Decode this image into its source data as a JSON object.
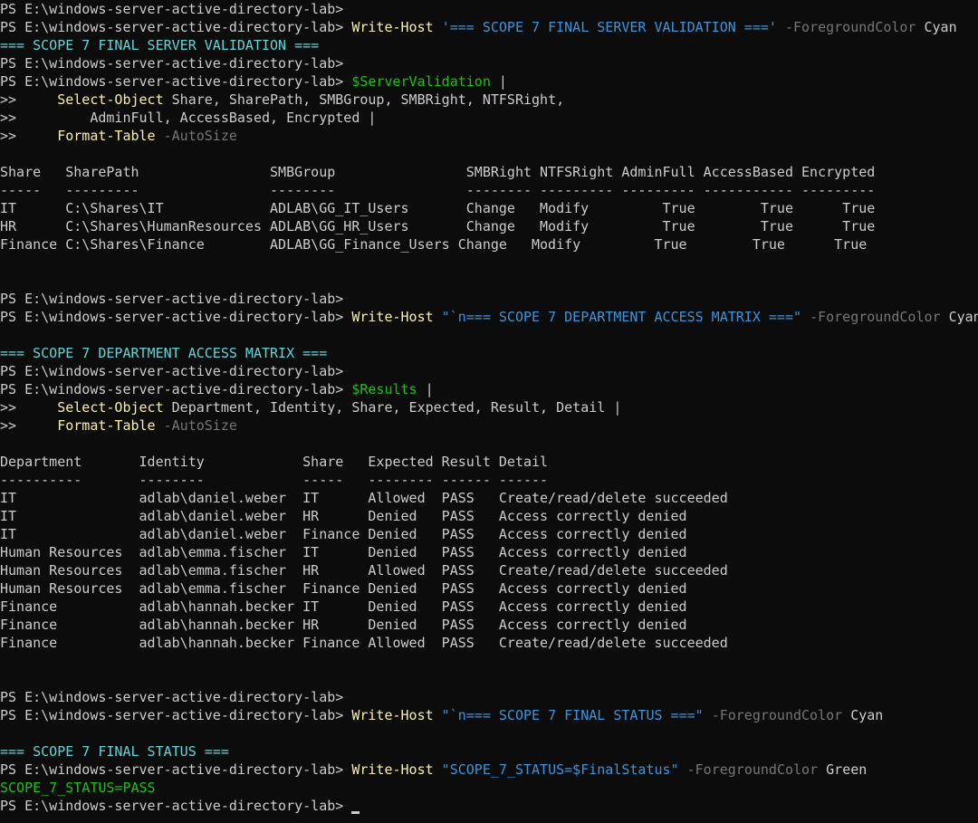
{
  "lines": [
    [
      {
        "t": "PS E:\\windows-server-active-directory-lab>",
        "c": "w"
      }
    ],
    [
      {
        "t": "PS E:\\windows-server-active-directory-lab> ",
        "c": "w"
      },
      {
        "t": "Write-Host",
        "c": "y"
      },
      {
        "t": " ",
        "c": "w"
      },
      {
        "t": "'=== SCOPE 7 FINAL SERVER VALIDATION ==='",
        "c": "c"
      },
      {
        "t": " ",
        "c": "w"
      },
      {
        "t": "-ForegroundColor",
        "c": "g"
      },
      {
        "t": " Cyan",
        "c": "w"
      }
    ],
    [
      {
        "t": "=== SCOPE 7 FINAL SERVER VALIDATION ===",
        "c": "cy"
      }
    ],
    [
      {
        "t": "PS E:\\windows-server-active-directory-lab>",
        "c": "w"
      }
    ],
    [
      {
        "t": "PS E:\\windows-server-active-directory-lab> ",
        "c": "w"
      },
      {
        "t": "$ServerValidation",
        "c": "gr"
      },
      {
        "t": " |",
        "c": "w"
      }
    ],
    [
      {
        "t": ">>     ",
        "c": "w"
      },
      {
        "t": "Select-Object",
        "c": "y"
      },
      {
        "t": " Share, SharePath, SMBGroup, SMBRight, NTFSRight,",
        "c": "w"
      }
    ],
    [
      {
        "t": ">>         AdminFull, AccessBased, Encrypted |",
        "c": "w"
      }
    ],
    [
      {
        "t": ">>     ",
        "c": "w"
      },
      {
        "t": "Format-Table",
        "c": "y"
      },
      {
        "t": " ",
        "c": "w"
      },
      {
        "t": "-AutoSize",
        "c": "g"
      }
    ],
    [],
    [
      {
        "t": "Share   SharePath                SMBGroup                SMBRight NTFSRight AdminFull AccessBased Encrypted",
        "c": "w"
      }
    ],
    [
      {
        "t": "-----   ---------                --------                -------- --------- --------- ----------- ---------",
        "c": "w"
      }
    ],
    [
      {
        "t": "IT      C:\\Shares\\IT             ADLAB\\GG_IT_Users       Change   Modify         True        True      True",
        "c": "w"
      }
    ],
    [
      {
        "t": "HR      C:\\Shares\\HumanResources ADLAB\\GG_HR_Users       Change   Modify         True        True      True",
        "c": "w"
      }
    ],
    [
      {
        "t": "Finance C:\\Shares\\Finance        ADLAB\\GG_Finance_Users Change   Modify         True        True      True",
        "c": "w"
      }
    ],
    [],
    [],
    [
      {
        "t": "PS E:\\windows-server-active-directory-lab>",
        "c": "w"
      }
    ],
    [
      {
        "t": "PS E:\\windows-server-active-directory-lab> ",
        "c": "w"
      },
      {
        "t": "Write-Host",
        "c": "y"
      },
      {
        "t": " ",
        "c": "w"
      },
      {
        "t": "\"`n=== SCOPE 7 DEPARTMENT ACCESS MATRIX ===\"",
        "c": "c"
      },
      {
        "t": " ",
        "c": "w"
      },
      {
        "t": "-ForegroundColor",
        "c": "g"
      },
      {
        "t": " Cyan",
        "c": "w"
      }
    ],
    [],
    [
      {
        "t": "=== SCOPE 7 DEPARTMENT ACCESS MATRIX ===",
        "c": "cy"
      }
    ],
    [
      {
        "t": "PS E:\\windows-server-active-directory-lab>",
        "c": "w"
      }
    ],
    [
      {
        "t": "PS E:\\windows-server-active-directory-lab> ",
        "c": "w"
      },
      {
        "t": "$Results",
        "c": "gr"
      },
      {
        "t": " |",
        "c": "w"
      }
    ],
    [
      {
        "t": ">>     ",
        "c": "w"
      },
      {
        "t": "Select-Object",
        "c": "y"
      },
      {
        "t": " Department, Identity, Share, Expected, Result, Detail |",
        "c": "w"
      }
    ],
    [
      {
        "t": ">>     ",
        "c": "w"
      },
      {
        "t": "Format-Table",
        "c": "y"
      },
      {
        "t": " ",
        "c": "w"
      },
      {
        "t": "-AutoSize",
        "c": "g"
      }
    ],
    [],
    [
      {
        "t": "Department       Identity            Share   Expected Result Detail",
        "c": "w"
      }
    ],
    [
      {
        "t": "----------       --------            -----   -------- ------ ------",
        "c": "w"
      }
    ],
    [
      {
        "t": "IT               adlab\\daniel.weber  IT      Allowed  PASS   Create/read/delete succeeded",
        "c": "w"
      }
    ],
    [
      {
        "t": "IT               adlab\\daniel.weber  HR      Denied   PASS   Access correctly denied",
        "c": "w"
      }
    ],
    [
      {
        "t": "IT               adlab\\daniel.weber  Finance Denied   PASS   Access correctly denied",
        "c": "w"
      }
    ],
    [
      {
        "t": "Human Resources  adlab\\emma.fischer  IT      Denied   PASS   Access correctly denied",
        "c": "w"
      }
    ],
    [
      {
        "t": "Human Resources  adlab\\emma.fischer  HR      Allowed  PASS   Create/read/delete succeeded",
        "c": "w"
      }
    ],
    [
      {
        "t": "Human Resources  adlab\\emma.fischer  Finance Denied   PASS   Access correctly denied",
        "c": "w"
      }
    ],
    [
      {
        "t": "Finance          adlab\\hannah.becker IT      Denied   PASS   Access correctly denied",
        "c": "w"
      }
    ],
    [
      {
        "t": "Finance          adlab\\hannah.becker HR      Denied   PASS   Access correctly denied",
        "c": "w"
      }
    ],
    [
      {
        "t": "Finance          adlab\\hannah.becker Finance Allowed  PASS   Create/read/delete succeeded",
        "c": "w"
      }
    ],
    [],
    [],
    [
      {
        "t": "PS E:\\windows-server-active-directory-lab>",
        "c": "w"
      }
    ],
    [
      {
        "t": "PS E:\\windows-server-active-directory-lab> ",
        "c": "w"
      },
      {
        "t": "Write-Host",
        "c": "y"
      },
      {
        "t": " ",
        "c": "w"
      },
      {
        "t": "\"`n=== SCOPE 7 FINAL STATUS ===\"",
        "c": "c"
      },
      {
        "t": " ",
        "c": "w"
      },
      {
        "t": "-ForegroundColor",
        "c": "g"
      },
      {
        "t": " Cyan",
        "c": "w"
      }
    ],
    [],
    [
      {
        "t": "=== SCOPE 7 FINAL STATUS ===",
        "c": "cy"
      }
    ],
    [
      {
        "t": "PS E:\\windows-server-active-directory-lab> ",
        "c": "w"
      },
      {
        "t": "Write-Host",
        "c": "y"
      },
      {
        "t": " ",
        "c": "w"
      },
      {
        "t": "\"SCOPE_7_STATUS=$FinalStatus\"",
        "c": "c"
      },
      {
        "t": " ",
        "c": "w"
      },
      {
        "t": "-ForegroundColor",
        "c": "g"
      },
      {
        "t": " Green",
        "c": "w"
      }
    ],
    [
      {
        "t": "SCOPE_7_STATUS=PASS",
        "c": "gr"
      }
    ],
    [
      {
        "t": "PS E:\\windows-server-active-directory-lab> ",
        "c": "w"
      }
    ]
  ],
  "colors": {
    "background": "#0c0c0c",
    "text": "#cccccc",
    "cmdlet": "#f9f1a5",
    "parameter": "#767676",
    "string": "#3a96dd",
    "variable": "#16c60c",
    "cyan_output": "#61d6d6",
    "green_output": "#16c60c"
  },
  "cursor": {
    "icon": "block-cursor-underscore"
  }
}
